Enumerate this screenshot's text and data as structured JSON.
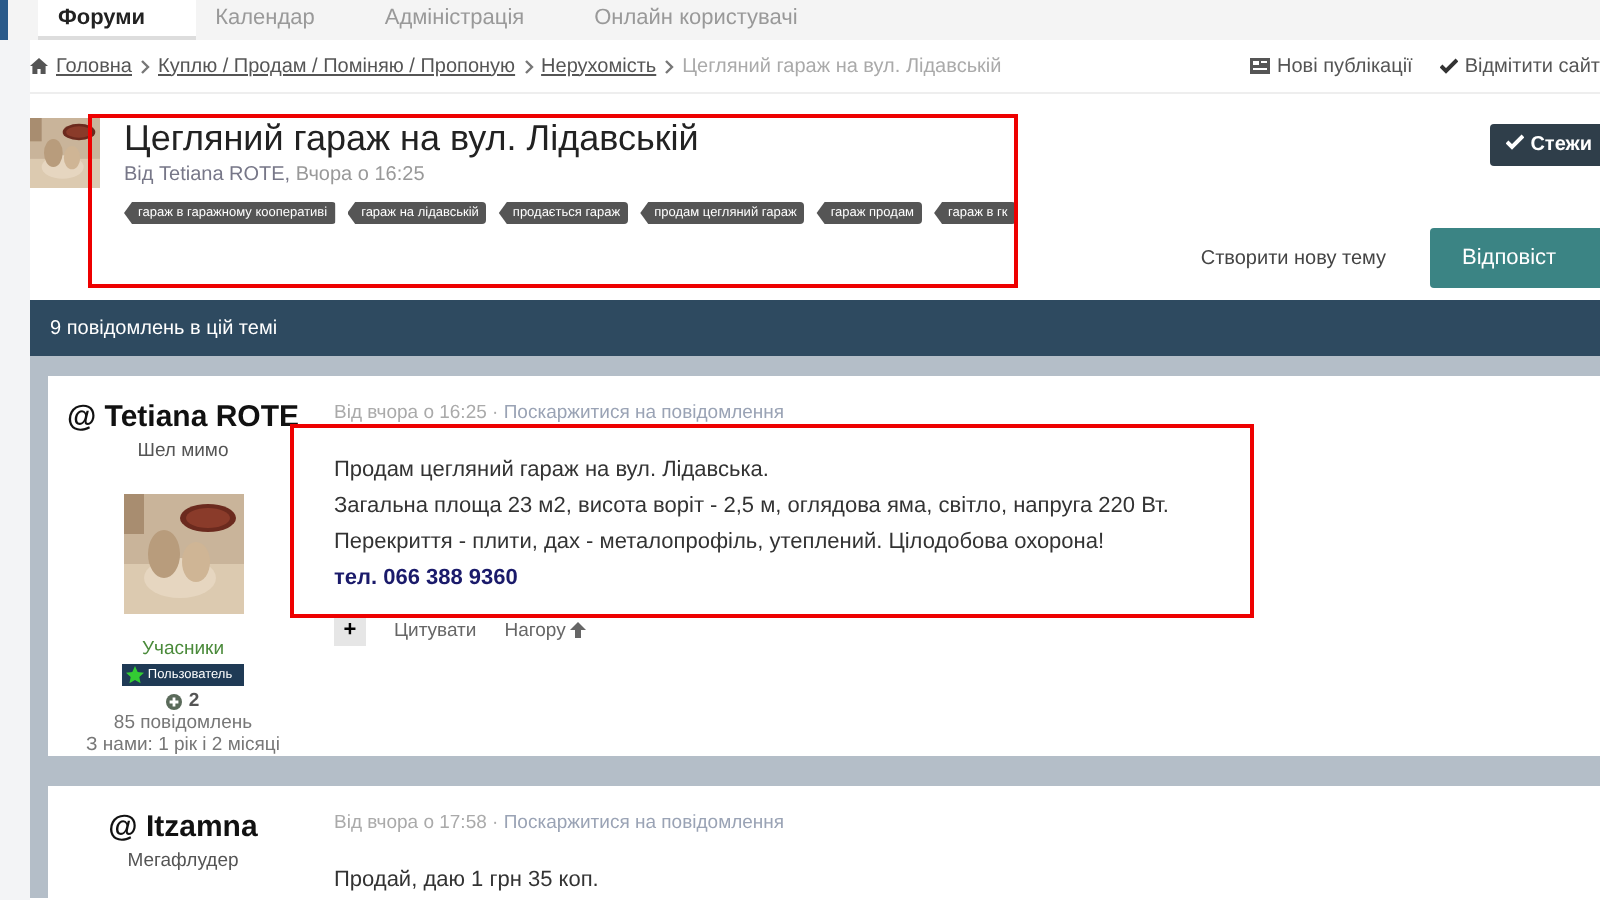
{
  "nav": {
    "tabs": [
      {
        "label": "Форуми",
        "selected": true
      },
      {
        "label": "Календар",
        "selected": false
      },
      {
        "label": "Адміністрація",
        "selected": false
      },
      {
        "label": "Онлайн користувачі",
        "selected": false
      }
    ]
  },
  "breadcrumb": {
    "items": [
      {
        "label": "Головна",
        "kind": "home"
      },
      {
        "label": "Куплю / Продам / Поміняю / Пропоную",
        "kind": "link"
      },
      {
        "label": "Нерухомість",
        "kind": "link"
      },
      {
        "label": "Цегляний гараж на вул. Лідавській",
        "kind": "current"
      }
    ],
    "actions": [
      "Нові публікації",
      "Відмітити сайт"
    ]
  },
  "topic": {
    "title": "Цегляний гараж на вул. Лідавській",
    "author": "Від Tetiana ROTE,",
    "time": "Вчора о 16:25",
    "tags": [
      "гараж в гаражному кооперативі",
      "гараж на лідавській",
      "продається гараж",
      "продам цегляний гараж",
      "гараж продам",
      "гараж в гк"
    ],
    "follow_button": "Стежи",
    "create_link": "Створити нову тему",
    "reply_button": "Відповіст"
  },
  "thread": {
    "header": "9 повідомлень в цій темі",
    "posts": [
      {
        "author": "@ Tetiana ROTE",
        "rank": "Шел мимо",
        "has_avatar": true,
        "group": "Учасники",
        "badge": "Пользователь",
        "reputation": "2",
        "posts_count": "85 повідомлень",
        "member_since": "З нами: 1 рік і 2 місяці",
        "meta": "Від вчора о 16:25 ·",
        "report": "Поскаржитися на повідомлення",
        "lines": [
          "Продам цегляний гараж на вул. Лідавська.",
          "Загальна площа 23 м2, висота воріт - 2,5 м, оглядова яма, світло, напруга 220 Вт.",
          "Перекриття - плити, дах - металопрофіль, утеплений. Цілодобова охорона!"
        ],
        "phone": "тел.  066 388 9360",
        "actions": [
          "+",
          "Цитувати",
          "Нагору"
        ],
        "highlighted": true
      },
      {
        "author": "@ Itzamna",
        "rank": "Мегафлудер",
        "has_avatar": false,
        "meta": "Від вчора о 17:58 ·",
        "report": "Поскаржитися на повідомлення",
        "lines": [
          "Продай, даю 1 грн 35 коп."
        ],
        "highlighted": false
      }
    ]
  }
}
